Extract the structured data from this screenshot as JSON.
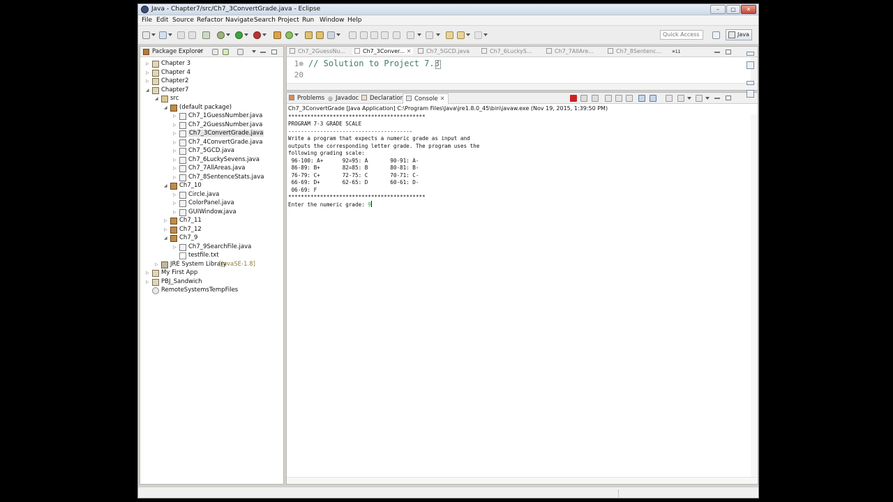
{
  "window": {
    "title": "Java - Chapter7/src/Ch7_3ConvertGrade.java - Eclipse"
  },
  "menu": [
    "File",
    "Edit",
    "Source",
    "Refactor",
    "Navigate",
    "Search",
    "Project",
    "Run",
    "Window",
    "Help"
  ],
  "toolbar": {
    "quick_access_placeholder": "Quick Access",
    "perspective": "Java"
  },
  "package_explorer": {
    "title": "Package Explorer",
    "tree": [
      {
        "label": "Chapter 3",
        "icon": "project-icon"
      },
      {
        "label": "Chapter 4",
        "icon": "project-icon"
      },
      {
        "label": "Chapter2",
        "icon": "project-icon"
      },
      {
        "label": "Chapter7",
        "icon": "project-icon"
      },
      {
        "label": "src",
        "icon": "source-folder-icon"
      },
      {
        "label": "(default package)",
        "icon": "package-icon"
      },
      {
        "label": "Ch7_1GuessNumber.java",
        "icon": "java-file-icon"
      },
      {
        "label": "Ch7_2GuessNumber.java",
        "icon": "java-file-icon"
      },
      {
        "label": "Ch7_3ConvertGrade.java",
        "icon": "java-file-icon"
      },
      {
        "label": "Ch7_4ConvertGrade.java",
        "icon": "java-file-icon"
      },
      {
        "label": "Ch7_5GCD.java",
        "icon": "java-file-icon"
      },
      {
        "label": "Ch7_6LuckySevens.java",
        "icon": "java-file-icon"
      },
      {
        "label": "Ch7_7AllAreas.java",
        "icon": "java-file-icon"
      },
      {
        "label": "Ch7_8SentenceStats.java",
        "icon": "java-file-icon"
      },
      {
        "label": "Ch7_10",
        "icon": "package-icon"
      },
      {
        "label": "Circle.java",
        "icon": "java-file-icon"
      },
      {
        "label": "ColorPanel.java",
        "icon": "java-file-icon"
      },
      {
        "label": "GUIWindow.java",
        "icon": "java-file-icon"
      },
      {
        "label": "Ch7_11",
        "icon": "package-icon"
      },
      {
        "label": "Ch7_12",
        "icon": "package-icon"
      },
      {
        "label": "Ch7_9",
        "icon": "package-icon"
      },
      {
        "label": "Ch7_9SearchFile.java",
        "icon": "java-file-icon"
      },
      {
        "label": "testfile.txt",
        "icon": "text-file-icon"
      },
      {
        "label": "JRE System Library",
        "suffix": "[JavaSE-1.8]",
        "icon": "library-icon"
      },
      {
        "label": "My First App",
        "icon": "project-icon"
      },
      {
        "label": "PBJ_Sandwich",
        "icon": "project-icon"
      },
      {
        "label": "RemoteSystemsTempFiles",
        "icon": "remote-icon"
      }
    ]
  },
  "editor": {
    "tabs": [
      "Ch7_2GuessNu...",
      "Ch7_3Conver...",
      "Ch7_5GCD.java",
      "Ch7_6LuckyS...",
      "Ch7_7AllAre...",
      "Ch7_8Sentenc..."
    ],
    "active_tab": "Ch7_3Conver...",
    "overflow_count": "11",
    "line_numbers": [
      "1⊕",
      "20"
    ],
    "code": "// Solution to Project 7.3"
  },
  "bottom_panel": {
    "tabs": [
      "Problems",
      "Javadoc",
      "Declaration",
      "Console"
    ],
    "active_tab": "Console",
    "launch_info": "Ch7_3ConvertGrade [Java Application] C:\\Program Files\\Java\\jre1.8.0_45\\bin\\javaw.exe (Nov 19, 2015, 1:39:50 PM)",
    "output": "*******************************************\nPROGRAM 7-3 GRADE SCALE\n---------------------------------------\nWrite a program that expects a numeric grade as input and\noutputs the corresponding letter grade. The program uses the\nfollowing grading scale:\n 96-100: A+      92=95: A       90-91: A-\n 86-89: B+       82=85: B       80-81: B-\n 76-79: C+       72-75: C       70-71: C-\n 66-69: D+       62-65: D       60-61: D-\n 06-69: F\n*******************************************\nEnter the numeric grade: ",
    "typed_input": "9"
  },
  "colors": {
    "comment_green": "#3f7f5f",
    "input_green": "#32a852",
    "terminate_red": "#cc2222"
  }
}
